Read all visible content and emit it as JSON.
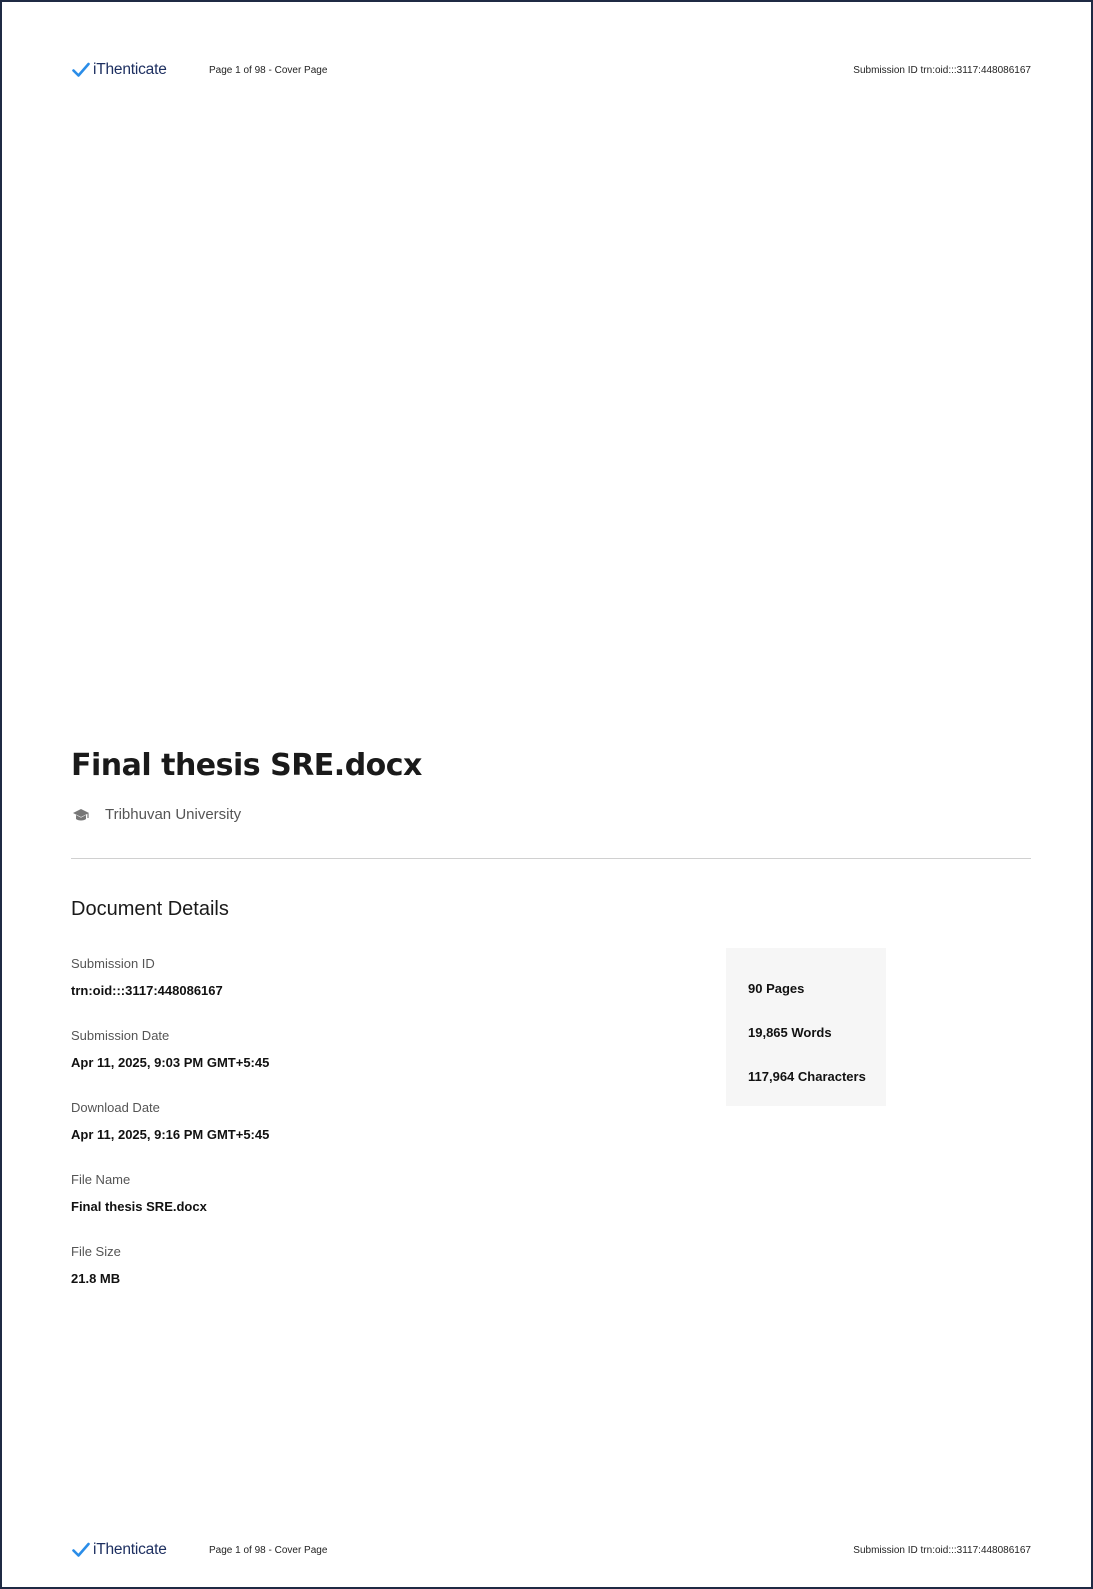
{
  "header": {
    "brand": "iThenticate",
    "page_label": "Page 1 of 98 - Cover Page",
    "submission_id_label": "Submission ID trn:oid:::3117:448086167"
  },
  "document": {
    "title": "Final thesis SRE.docx",
    "institution": "Tribhuvan University",
    "institution_icon": "graduation-cap-icon"
  },
  "details": {
    "heading": "Document Details",
    "items": [
      {
        "label": "Submission ID",
        "value": "trn:oid:::3117:448086167"
      },
      {
        "label": "Submission Date",
        "value": "Apr 11, 2025, 9:03 PM GMT+5:45"
      },
      {
        "label": "Download Date",
        "value": "Apr 11, 2025, 9:16 PM GMT+5:45"
      },
      {
        "label": "File Name",
        "value": "Final thesis SRE.docx"
      },
      {
        "label": "File Size",
        "value": "21.8 MB"
      }
    ]
  },
  "stats": {
    "pages": "90 Pages",
    "words": "19,865 Words",
    "characters": "117,964 Characters"
  },
  "footer": {
    "brand": "iThenticate",
    "page_label": "Page 1 of 98 - Cover Page",
    "submission_id_label": "Submission ID trn:oid:::3117:448086167"
  },
  "colors": {
    "brand_check": "#2b8de8",
    "brand_text": "#1d2f60",
    "page_border": "#1f2a44",
    "stats_bg": "#f6f6f6"
  }
}
